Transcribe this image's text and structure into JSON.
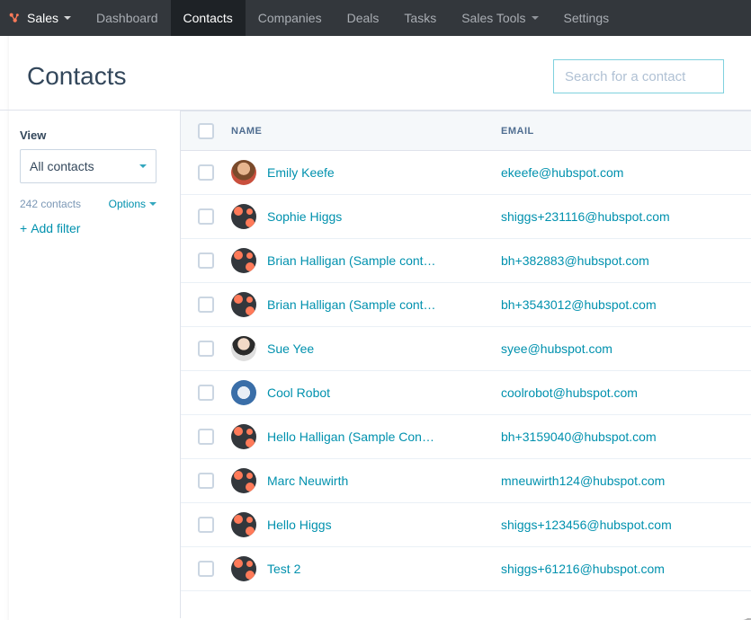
{
  "nav": {
    "brand": "Sales",
    "items": [
      "Dashboard",
      "Contacts",
      "Companies",
      "Deals",
      "Tasks",
      "Sales Tools",
      "Settings"
    ],
    "active": "Contacts"
  },
  "page": {
    "title": "Contacts",
    "search_placeholder": "Search for a contact"
  },
  "sidebar": {
    "view_label": "View",
    "view_value": "All contacts",
    "count_text": "242 contacts",
    "options_label": "Options",
    "add_filter_label": "Add filter"
  },
  "table": {
    "headers": {
      "name": "NAME",
      "email": "EMAIL"
    },
    "rows": [
      {
        "name": "Emily Keefe",
        "email": "ekeefe@hubspot.com",
        "avatar": "photo1"
      },
      {
        "name": "Sophie Higgs",
        "email": "shiggs+231116@hubspot.com",
        "avatar": "sprocket"
      },
      {
        "name": "Brian Halligan (Sample cont…",
        "email": "bh+382883@hubspot.com",
        "avatar": "sprocket"
      },
      {
        "name": "Brian Halligan (Sample cont…",
        "email": "bh+3543012@hubspot.com",
        "avatar": "sprocket"
      },
      {
        "name": "Sue Yee",
        "email": "syee@hubspot.com",
        "avatar": "photo2"
      },
      {
        "name": "Cool Robot",
        "email": "coolrobot@hubspot.com",
        "avatar": "robot"
      },
      {
        "name": "Hello Halligan (Sample Con…",
        "email": "bh+3159040@hubspot.com",
        "avatar": "sprocket"
      },
      {
        "name": "Marc Neuwirth",
        "email": "mneuwirth124@hubspot.com",
        "avatar": "sprocket"
      },
      {
        "name": "Hello Higgs",
        "email": "shiggs+123456@hubspot.com",
        "avatar": "sprocket"
      },
      {
        "name": "Test 2",
        "email": "shiggs+61216@hubspot.com",
        "avatar": "sprocket"
      }
    ]
  }
}
